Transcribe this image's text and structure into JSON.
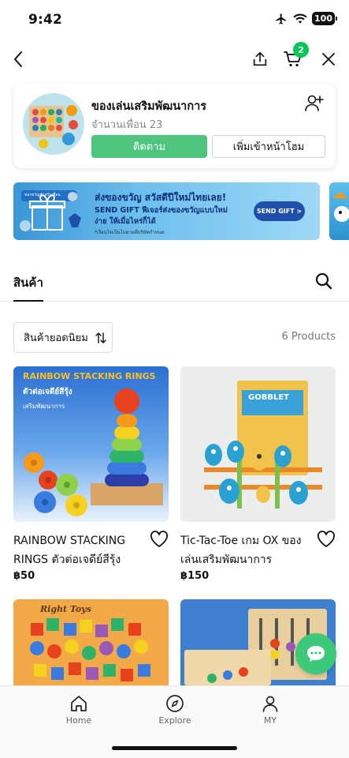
{
  "status_bar": {
    "time": "9:42",
    "battery": "100"
  },
  "header": {
    "cart_count": "2"
  },
  "profile": {
    "name": "ของเล่นเสริมพัฒนาการ",
    "friends": "จำนวนเพื่อน 23",
    "follow_label": "ติดตาม",
    "add_home_label": "เพิ่มเข้าหน้าโฮม"
  },
  "banner": {
    "title": "ส่งของขวัญ สวัสดีปีใหม่ไทยเลย!",
    "line1": "SEND GIFT ฟีเจอร์ส่งของขวัญแบบใหม่",
    "line2": "ง่าย ให้เมื่อไหร่ก็ได้",
    "note": "*เงื่อนไขเป็นไปตามที่บริษัทกำหนด",
    "cta": "SEND GIFT >",
    "badge": "ของขวัญสำหรับเพื่อน"
  },
  "products_tab": {
    "label": "สินค้า"
  },
  "sort": {
    "label": "สินค้ายอดนิยม",
    "count": "6 Products"
  },
  "products": [
    {
      "name": "RAINBOW STACKING RINGS ตัวต่อเจดีย์สีรุ้ง",
      "price": "฿50",
      "image_title": "RAINBOW STACKING RINGS",
      "image_subtitle": "ตัวต่อเจดีย์สีรุ้ง",
      "image_caption": "เสริมพัฒนาการ"
    },
    {
      "name": "Tic-Tac-Toe เกม OX ของเล่นเสริมพัฒนาการ",
      "price": "฿150",
      "image_title": "GOBBLET"
    },
    {
      "name": "",
      "price": "",
      "image_title": "Right Toys"
    },
    {
      "name": "",
      "price": ""
    }
  ],
  "bottom_nav": [
    {
      "label": "Home",
      "icon": "home-icon"
    },
    {
      "label": "Explore",
      "icon": "compass-icon"
    },
    {
      "label": "MY",
      "icon": "person-icon"
    }
  ],
  "colors": {
    "accent": "#06c755",
    "follow": "#4ec47f",
    "chat": "#3cc97a"
  }
}
